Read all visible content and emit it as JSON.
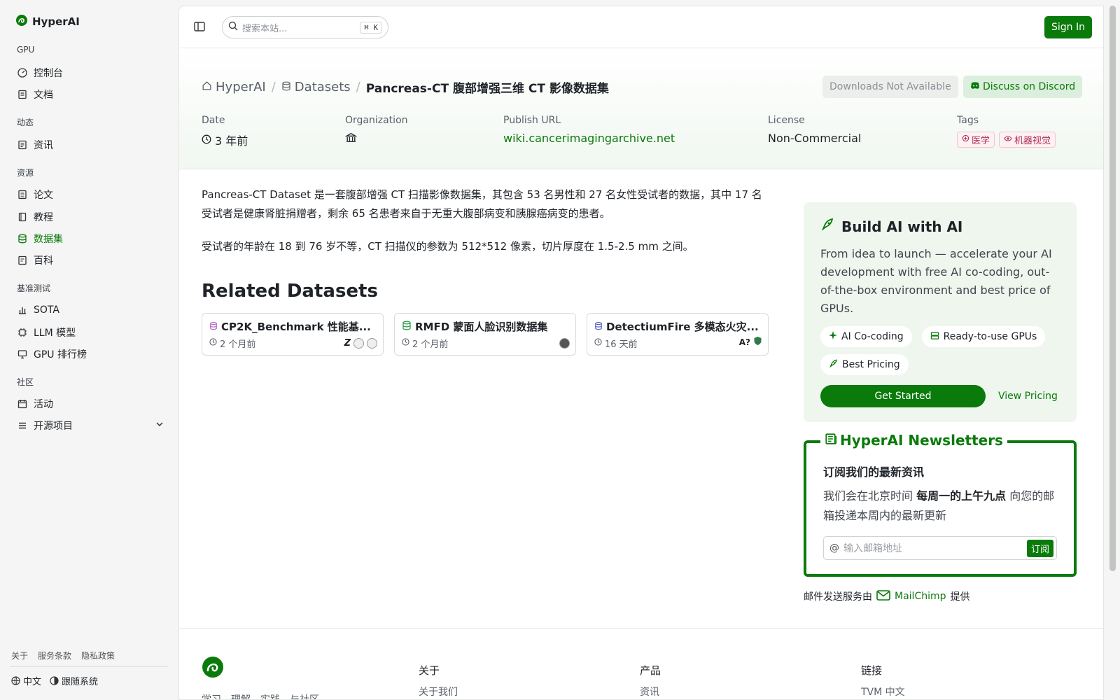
{
  "brand": {
    "name": "HyperAI"
  },
  "sidebar": {
    "sections": [
      {
        "label": "GPU",
        "items": [
          {
            "label": "控制台",
            "icon": "gauge-icon"
          },
          {
            "label": "文档",
            "icon": "doc-icon"
          }
        ]
      },
      {
        "label": "动态",
        "items": [
          {
            "label": "资讯",
            "icon": "news-icon"
          }
        ]
      },
      {
        "label": "资源",
        "items": [
          {
            "label": "论文",
            "icon": "paper-icon"
          },
          {
            "label": "教程",
            "icon": "book-icon"
          },
          {
            "label": "数据集",
            "icon": "database-icon"
          },
          {
            "label": "百科",
            "icon": "wiki-icon"
          }
        ]
      },
      {
        "label": "基准测试",
        "items": [
          {
            "label": "SOTA",
            "icon": "bar-chart-icon"
          },
          {
            "label": "LLM 模型",
            "icon": "chip-icon"
          },
          {
            "label": "GPU 排行榜",
            "icon": "monitor-icon"
          }
        ]
      },
      {
        "label": "社区",
        "items": [
          {
            "label": "活动",
            "icon": "calendar-icon"
          },
          {
            "label": "开源项目",
            "icon": "list-icon"
          }
        ]
      }
    ],
    "footer_links": [
      "关于",
      "服务条款",
      "隐私政策"
    ],
    "language": "中文",
    "theme": "跟随系统"
  },
  "topbar": {
    "search_placeholder": "搜索本站...",
    "shortcut": "⌘ K",
    "signin": "Sign In"
  },
  "breadcrumb": {
    "home": "HyperAI",
    "section": "Datasets",
    "current": "Pancreas-CT 腹部增强三维 CT 影像数据集"
  },
  "header_buttons": {
    "downloads": "Downloads Not Available",
    "discord": "Discuss on Discord"
  },
  "meta": {
    "date_label": "Date",
    "date_value": "3 年前",
    "org_label": "Organization",
    "url_label": "Publish URL",
    "url_value": "wiki.cancerimagingarchive.net",
    "license_label": "License",
    "license_value": "Non-Commercial",
    "tags_label": "Tags",
    "tags": [
      "医学",
      "机器视觉"
    ]
  },
  "description": [
    "Pancreas-CT Dataset 是一套腹部增强 CT 扫描影像数据集，其包含 53 名男性和 27 名女性受试者的数据，其中 17 名受试者是健康肾脏捐赠者，剩余 65 名患者来自于无重大腹部病变和胰腺癌病变的患者。",
    "受试者的年龄在 18 到 76 岁不等，CT 扫描仪的参数为 512*512 像素，切片厚度在 1.5-2.5 mm 之间。"
  ],
  "related": {
    "title": "Related Datasets",
    "cards": [
      {
        "title": "CP2K_Benchmark 性能基...",
        "time": "2 个月前",
        "color": "#b061c9"
      },
      {
        "title": "RMFD 蒙面人脸识别数据集",
        "time": "2 个月前",
        "color": "#2e9e4f"
      },
      {
        "title": "DetectiumFire 多模态火灾...",
        "time": "16 天前",
        "color": "#5a5fc9"
      }
    ]
  },
  "build": {
    "title": "Build AI with AI",
    "desc": "From idea to launch — accelerate your AI development with free AI co-coding, out-of-the-box environment and best price of GPUs.",
    "chips": [
      "AI Co-coding",
      "Ready-to-use GPUs",
      "Best Pricing"
    ],
    "cta": "Get Started",
    "pricing": "View Pricing"
  },
  "newsletter": {
    "title": "HyperAI Newsletters",
    "subtitle": "订阅我们的最新资讯",
    "text_a": "我们会在北京时间 ",
    "text_b": "每周一的上午九点",
    "text_c": " 向您的邮箱投递本周内的最新更新",
    "email_placeholder": "输入邮箱地址",
    "subscribe": "订阅",
    "provided_a": "邮件发送服务由",
    "provider": "MailChimp",
    "provided_b": "提供"
  },
  "footer": {
    "learn": [
      "学习",
      "理解",
      "实践",
      "与社区"
    ],
    "cols": [
      {
        "heading": "关于",
        "link": "关于我们"
      },
      {
        "heading": "产品",
        "link": "资讯"
      },
      {
        "heading": "链接",
        "link": "TVM 中文"
      }
    ]
  },
  "colors": {
    "accent": "#0a7a0a",
    "accent_light": "#eef6ee"
  }
}
